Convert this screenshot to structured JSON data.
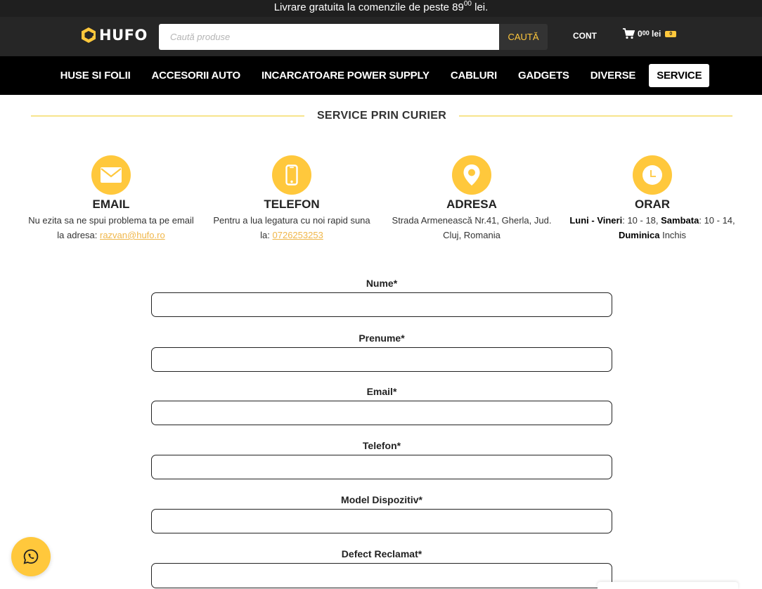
{
  "topbar": {
    "text_before": "Livrare gratuita la comenzile de peste 89",
    "text_sup": "00",
    "text_after": " lei."
  },
  "header": {
    "logo_text": "HUFO",
    "search_placeholder": "Caută produse",
    "search_button": "CAUTĂ",
    "account": "CONT",
    "cart_amount": "0",
    "cart_decimals": "00",
    "cart_currency": "lei",
    "cart_count": "0"
  },
  "nav": {
    "items": [
      "HUSE SI FOLII",
      "ACCESORII AUTO",
      "INCARCATOARE POWER SUPPLY",
      "CABLURI",
      "GADGETS",
      "DIVERSE",
      "SERVICE"
    ]
  },
  "section": {
    "title": "SERVICE PRIN CURIER"
  },
  "contact": {
    "email": {
      "title": "EMAIL",
      "text": "Nu ezita sa ne spui problema ta pe email la adresa: ",
      "link": "razvan@hufo.ro"
    },
    "phone": {
      "title": "TELEFON",
      "text": "Pentru a lua legatura cu noi rapid suna la: ",
      "link": "0726253253"
    },
    "address": {
      "title": "ADRESA",
      "text": "Strada Armenească Nr.41, Gherla, Jud. Cluj, Romania"
    },
    "hours": {
      "title": "ORAR",
      "weekdays_label": "Luni - Vineri",
      "weekdays_hours": ": 10 - 18, ",
      "saturday_label": "Sambata",
      "saturday_hours": ": 10 - 14, ",
      "sunday_label": "Duminica",
      "sunday_hours": " Inchis"
    }
  },
  "form": {
    "fields": [
      {
        "label": "Nume*",
        "value": ""
      },
      {
        "label": "Prenume*",
        "value": ""
      },
      {
        "label": "Email*",
        "value": ""
      },
      {
        "label": "Telefon*",
        "value": ""
      },
      {
        "label": "Model Dispozitiv*",
        "value": ""
      },
      {
        "label": "Defect Reclamat*",
        "value": ""
      }
    ]
  },
  "colors": {
    "accent": "#ffc83c",
    "header_bg": "#262626",
    "nav_bg": "#000000",
    "link": "#f0b74a"
  },
  "icons": {
    "logo": "hufo-logo-icon",
    "cart": "cart-icon",
    "email": "envelope-icon",
    "phone": "phone-icon",
    "address": "location-pin-icon",
    "hours": "clock-icon",
    "chat": "whatsapp-icon"
  }
}
